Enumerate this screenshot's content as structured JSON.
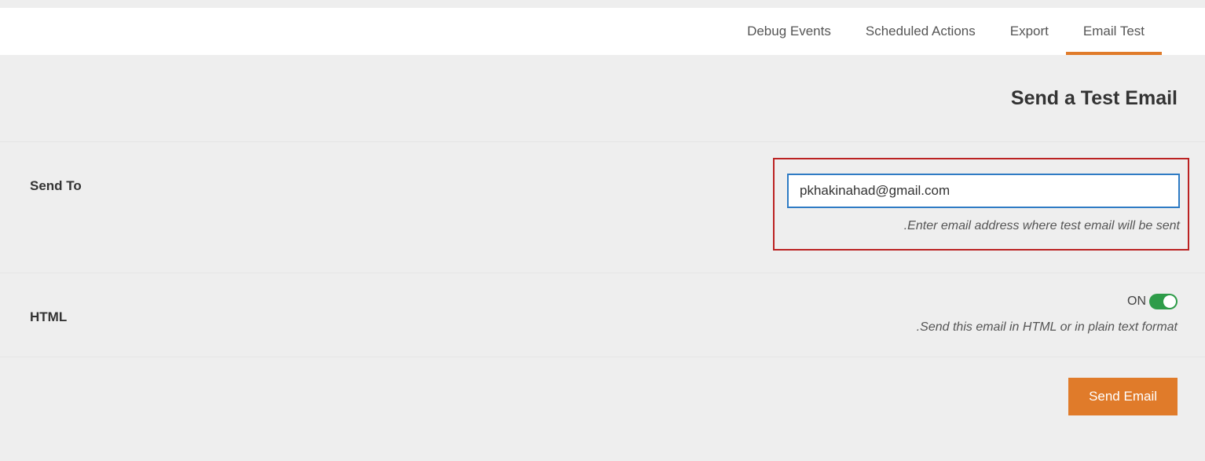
{
  "tabs": {
    "debug_events": "Debug Events",
    "scheduled_actions": "Scheduled Actions",
    "export": "Export",
    "email_test": "Email Test"
  },
  "page": {
    "title": "Send a Test Email"
  },
  "form": {
    "send_to": {
      "label": "Send To",
      "value": "pkhakinahad@gmail.com",
      "help": "Enter email address where test email will be sent"
    },
    "html": {
      "label": "HTML",
      "toggle_state_text": "ON",
      "help": "Send this email in HTML or in plain text format"
    }
  },
  "actions": {
    "send": "Send Email"
  }
}
